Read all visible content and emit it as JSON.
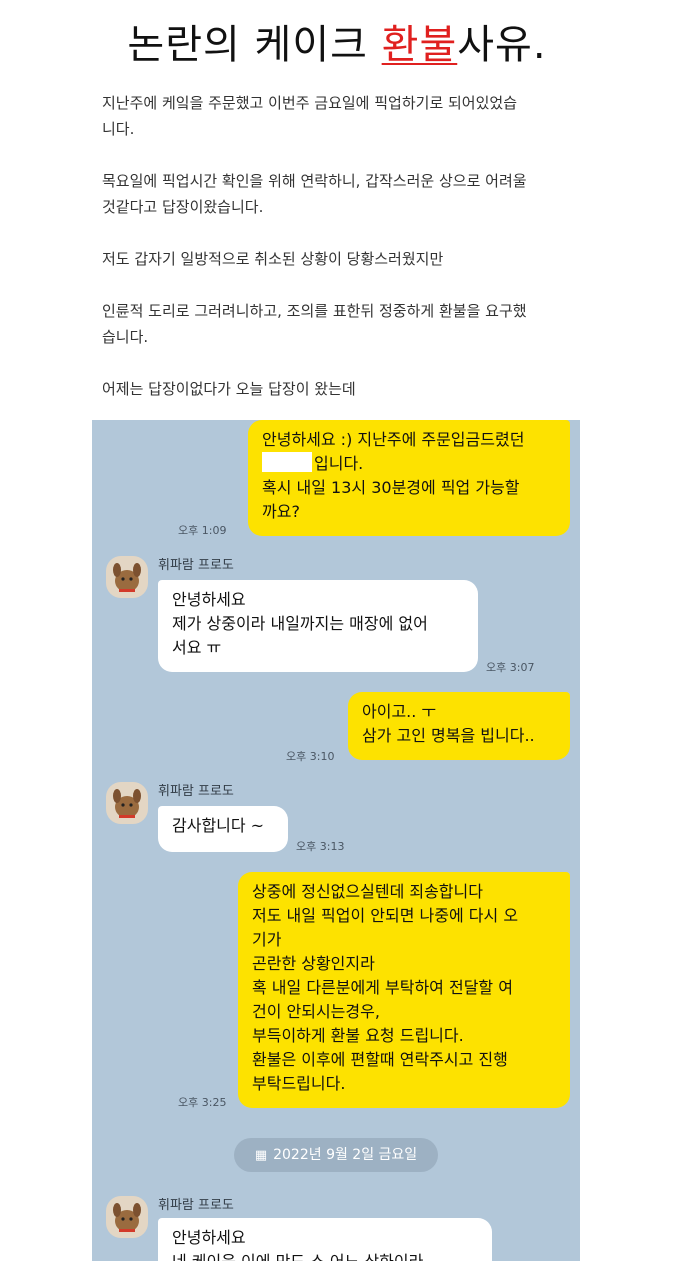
{
  "headline": {
    "before": "논란의 케이크 ",
    "highlight": "환불",
    "after": "사유."
  },
  "post": {
    "p1": "지난주에 케잌을 주문했고 이번주 금요일에 픽업하기로 되어있었습\n니다.",
    "p2": "목요일에 픽업시간 확인을 위해 연락하니, 갑작스러운 상으로 어려울\n것같다고 답장이왔습니다.",
    "p3": "저도 갑자기 일방적으로 취소된 상황이 당황스러웠지만",
    "p4": "인륜적 도리로 그러려니하고, 조의를 표한뒤 정중하게 환불을 요구했\n습니다.",
    "p5": "어제는 답장이없다가 오늘 답장이 왔는데"
  },
  "chat": {
    "sender_name": "휘파람 프로도",
    "messages": [
      {
        "from": "me",
        "pre": "안녕하세요 :) 지난주에 주문입금드렸던\n",
        "post": "입니다.\n혹시 내일 13시 30분경에 픽업 가능할\n까요?",
        "time": "오후 1:09"
      },
      {
        "from": "you",
        "text": "안녕하세요\n제가 상중이라 내일까지는 매장에 없어\n서요 ㅠ",
        "time": "오후 3:07"
      },
      {
        "from": "me",
        "text": "아이고.. ㅜ\n삼가 고인 명복을 빕니다..",
        "time": "오후 3:10"
      },
      {
        "from": "you",
        "text": "감사합니다 ~",
        "time": "오후 3:13"
      },
      {
        "from": "me",
        "text": "상중에 정신없으실텐데 죄송합니다\n저도 내일 픽업이 안되면 나중에 다시 오\n기가\n곤란한 상황인지라\n혹 내일 다른분에게 부탁하여 전달할 여\n건이 안되시는경우,\n부득이하게 환불 요청 드립니다.\n환불은 이후에 편할때 연락주시고 진행\n부탁드립니다.",
        "time": "오후 3:25"
      },
      {
        "from": "you",
        "text": "안녕하세요\n네 케이읏 이에 만드 스 어느 상화이라",
        "time": ""
      }
    ],
    "date_divider": "2022년 9월 2일 금요일"
  },
  "colors": {
    "my_bubble": "#fde200",
    "their_bubble": "#ffffff",
    "chat_bg": "#b2c7d9",
    "highlight": "#e0201f"
  },
  "icons": {
    "calendar": "calendar-icon",
    "avatar": "dog-avatar-icon"
  }
}
